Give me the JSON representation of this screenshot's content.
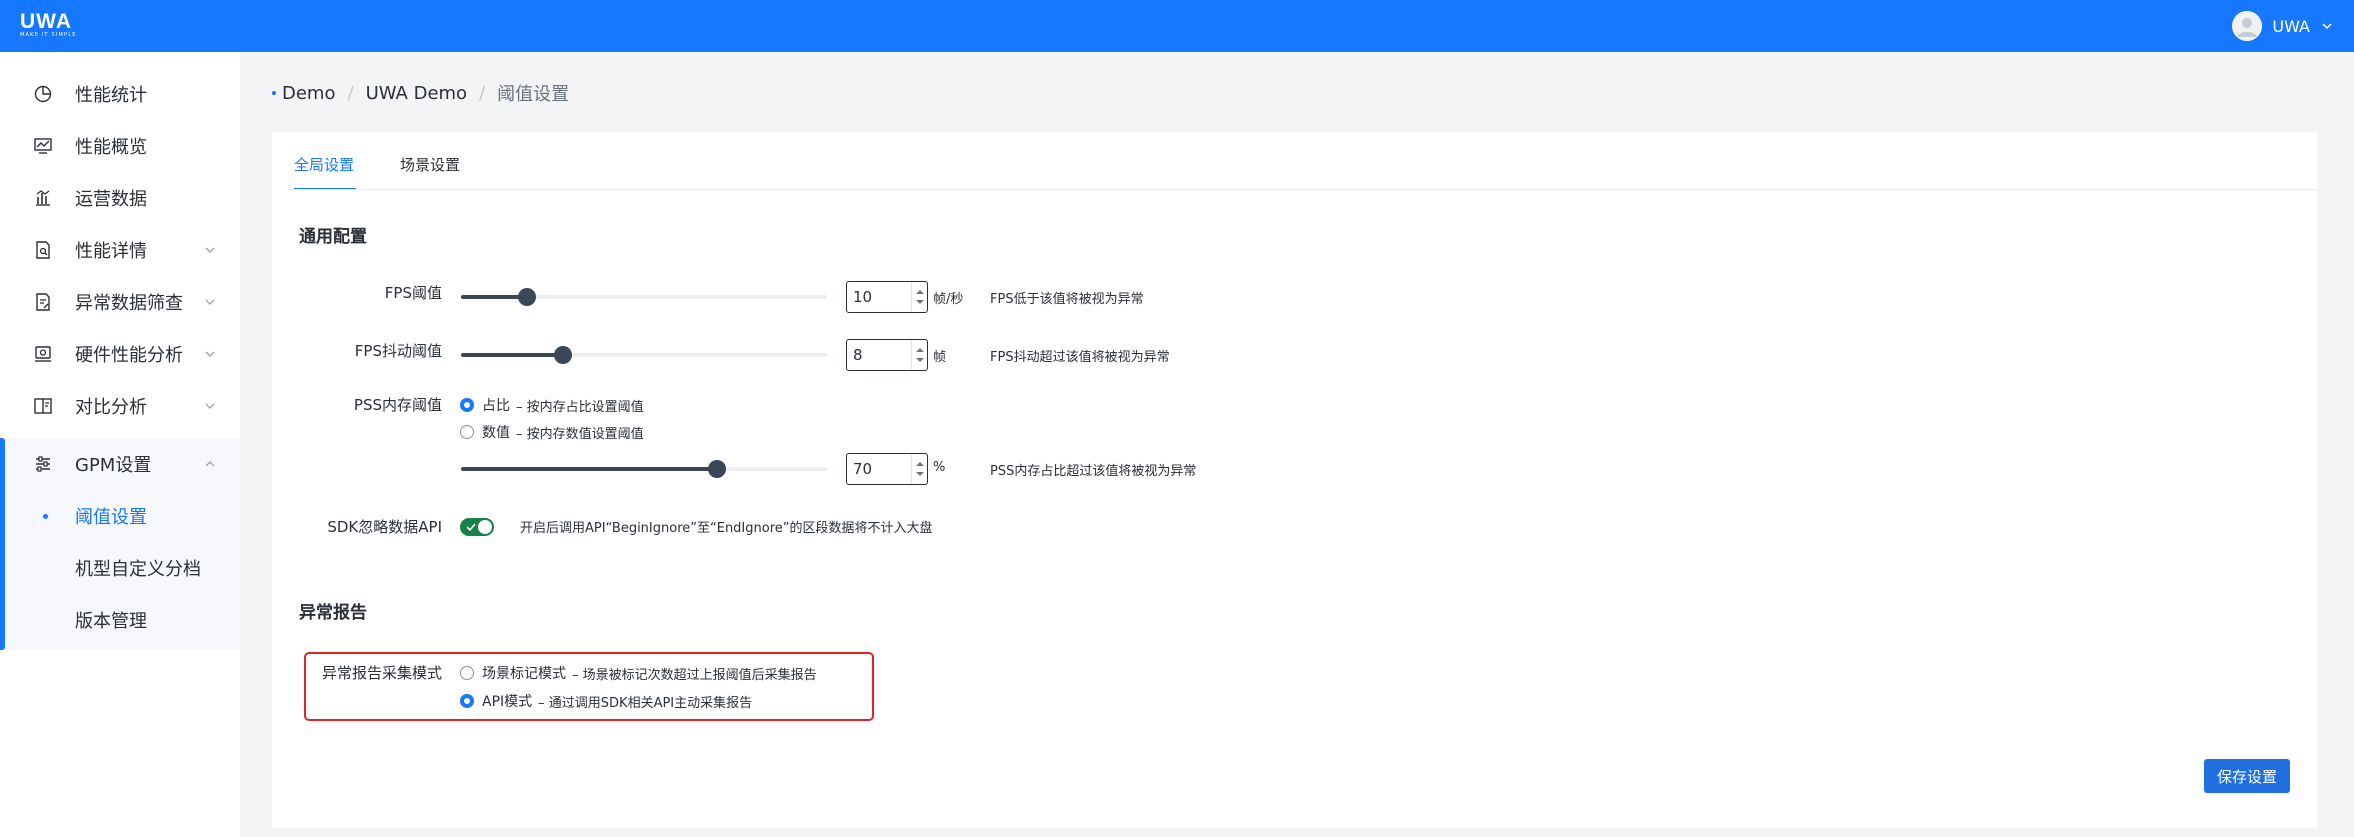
{
  "header": {
    "logo_text": "UWA",
    "logo_sub": "MAKE IT SIMPLE",
    "user_name": "UWA"
  },
  "sidebar": {
    "items": [
      {
        "label": "性能统计",
        "icon": "pie-chart-icon"
      },
      {
        "label": "性能概览",
        "icon": "monitor-chart-icon"
      },
      {
        "label": "运营数据",
        "icon": "bar-chart-icon"
      },
      {
        "label": "性能详情",
        "icon": "document-search-icon"
      },
      {
        "label": "异常数据筛查",
        "icon": "document-edit-icon"
      },
      {
        "label": "硬件性能分析",
        "icon": "device-icon"
      },
      {
        "label": "对比分析",
        "icon": "compare-icon"
      },
      {
        "label": "GPM设置",
        "icon": "sliders-icon"
      }
    ],
    "sub_items": [
      {
        "label": "阈值设置"
      },
      {
        "label": "机型自定义分档"
      },
      {
        "label": "版本管理"
      }
    ]
  },
  "breadcrumb": {
    "items": [
      "Demo",
      "UWA Demo",
      "阈值设置"
    ],
    "separator": "/"
  },
  "tabs": [
    {
      "label": "全局设置"
    },
    {
      "label": "场景设置"
    }
  ],
  "general": {
    "title": "通用配置",
    "fps": {
      "label": "FPS阈值",
      "value": "10",
      "unit": "帧/秒",
      "hint": "FPS低于该值将被视为异常",
      "slider_fraction": 0.18
    },
    "fps_jitter": {
      "label": "FPS抖动阈值",
      "value": "8",
      "unit": "帧",
      "hint": "FPS抖动超过该值将被视为异常",
      "slider_fraction": 0.28
    },
    "pss": {
      "label": "PSS内存阈值",
      "options": [
        {
          "label": "占比",
          "desc": "– 按内存占比设置阈值",
          "checked": true
        },
        {
          "label": "数值",
          "desc": "– 按内存数值设置阈值",
          "checked": false
        }
      ],
      "value": "70",
      "unit": "%",
      "hint": "PSS内存占比超过该值将被视为异常",
      "slider_fraction": 0.7
    },
    "sdk_ignore": {
      "label": "SDK忽略数据API",
      "enabled": true,
      "hint": "开启后调用API“BeginIgnore”至“EndIgnore”的区段数据将不计入大盘"
    }
  },
  "report": {
    "title": "异常报告",
    "mode_label": "异常报告采集模式",
    "options": [
      {
        "label": "场景标记模式",
        "desc": "– 场景被标记次数超过上报阈值后采集报告",
        "checked": false
      },
      {
        "label": "API模式",
        "desc": "– 通过调用SDK相关API主动采集报告",
        "checked": true
      }
    ]
  },
  "save_label": "保存设置",
  "colors": {
    "brand": "#1677ff",
    "toggle_on": "#18804a",
    "highlight": "#e02424",
    "slider": "#3b4656"
  }
}
